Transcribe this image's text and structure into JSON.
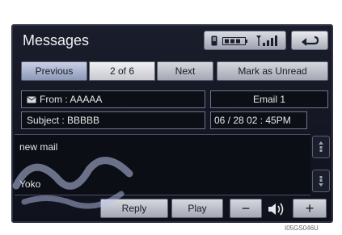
{
  "header": {
    "title": "Messages"
  },
  "navigation": {
    "previous_label": "Previous",
    "page_indicator": "2 of 6",
    "next_label": "Next",
    "mark_unread_label": "Mark as Unread"
  },
  "message": {
    "from": "From : AAAAA",
    "mailbox": "Email 1",
    "subject": "Subject : BBBBB",
    "datetime": "06 / 28  02 : 45PM",
    "body": "new mail",
    "signature": "Yoko"
  },
  "actions": {
    "reply_label": "Reply",
    "play_label": "Play",
    "volume_down_label": "−",
    "volume_up_label": "+"
  },
  "footer": {
    "image_code": "I05GS046U"
  },
  "icons": {
    "back": "back-arrow-icon",
    "phone": "phone-icon",
    "battery": "battery-icon",
    "signal": "signal-icon",
    "envelope": "envelope-icon",
    "scroll_up": "scroll-up-icon",
    "scroll_down": "scroll-down-icon",
    "speaker": "speaker-icon"
  },
  "colors": {
    "screen_bg": "#14172a",
    "button_face": "#c4c7d0",
    "text": "#e6e6e6"
  }
}
